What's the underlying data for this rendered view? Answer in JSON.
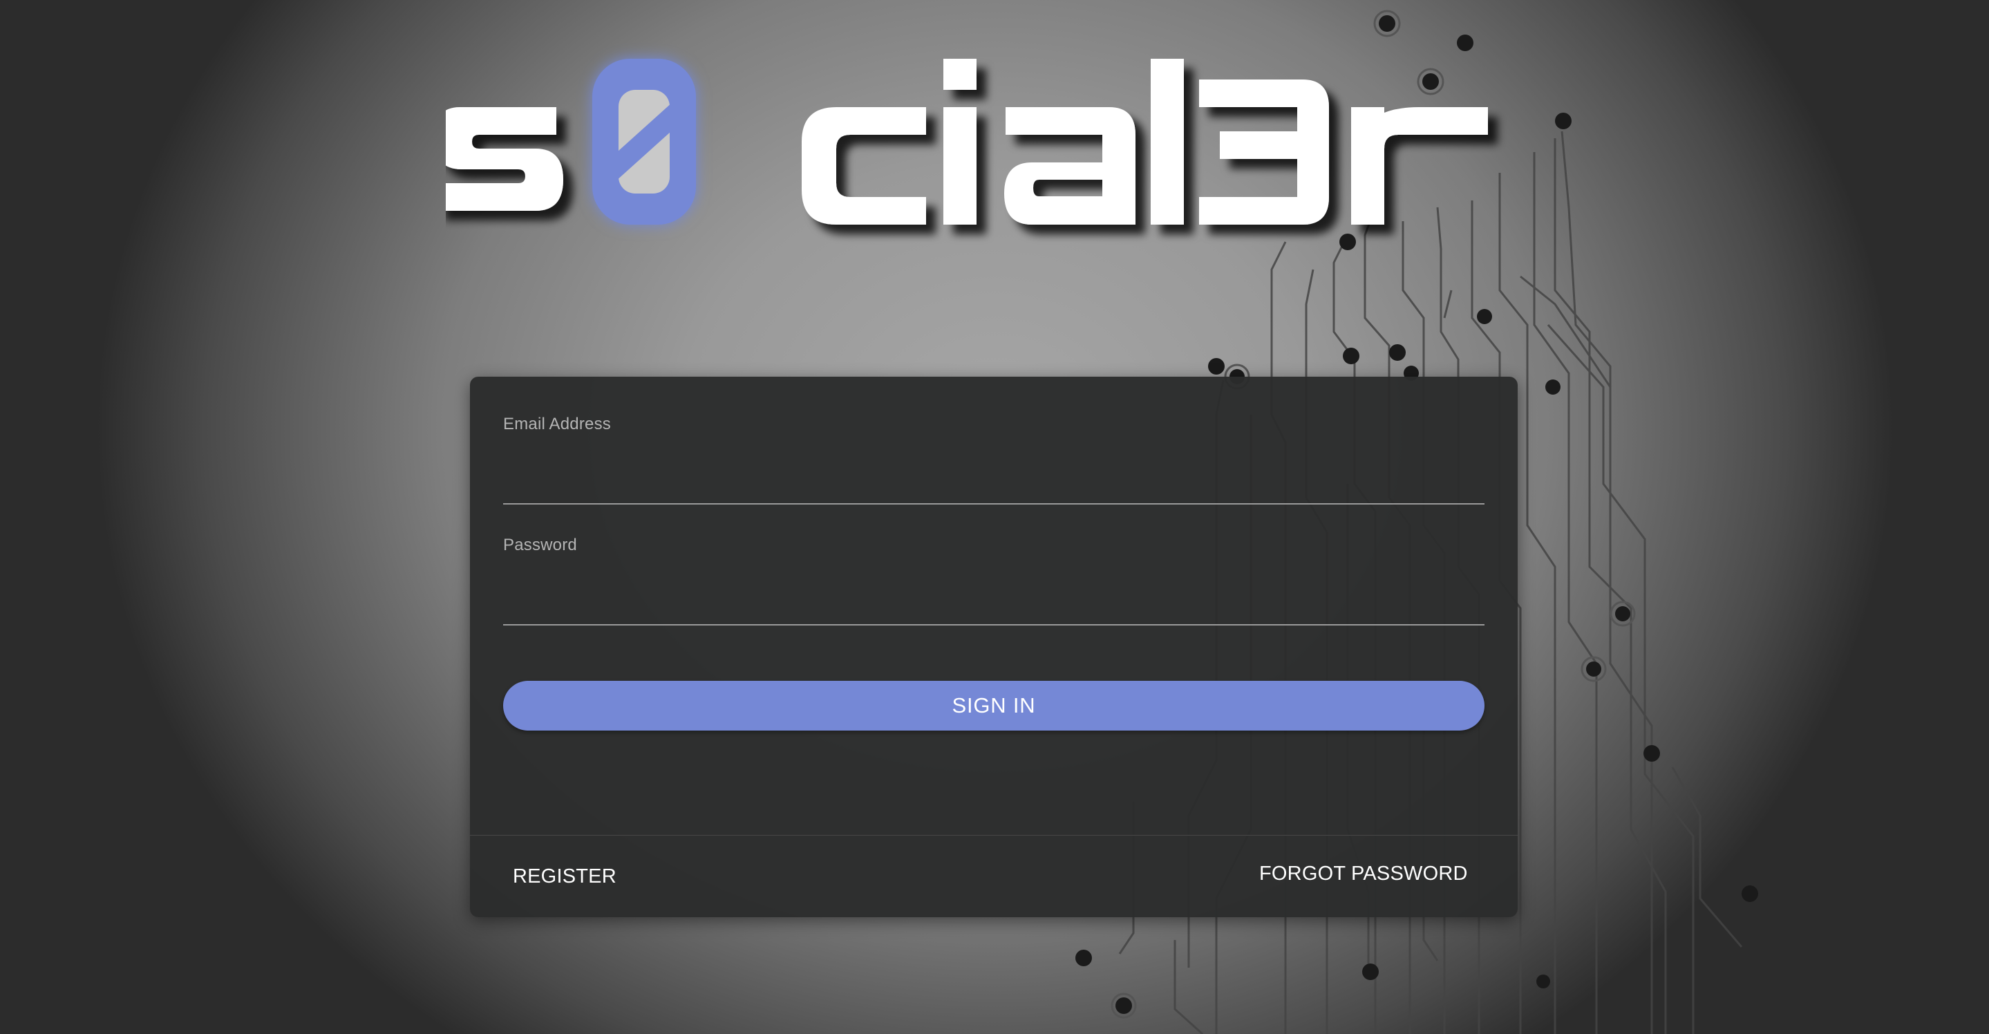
{
  "app": {
    "logo_text": "s0cial3r",
    "accent_color": "#7588d6"
  },
  "login": {
    "email_label": "Email Address",
    "email_value": "",
    "password_label": "Password",
    "password_value": "",
    "sign_in_label": "SIGN IN",
    "register_label": "REGISTER",
    "forgot_password_label": "FORGOT PASSWORD"
  },
  "background": {
    "pattern": "circuit-board"
  }
}
